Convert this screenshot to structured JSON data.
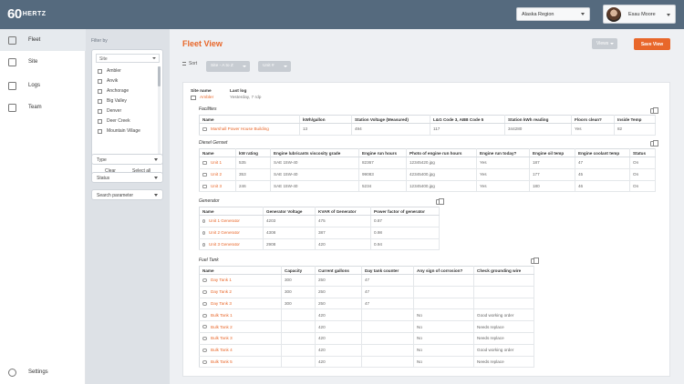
{
  "topbar": {
    "logo_main": "60",
    "logo_sub": "HERTZ",
    "region": "Alaska Region",
    "user": "Esau Moore"
  },
  "sidebar": {
    "items": [
      {
        "label": "Fleet",
        "icon": "hierarchy-icon"
      },
      {
        "label": "Site",
        "icon": "building-icon"
      },
      {
        "label": "Logs",
        "icon": "clipboard-icon"
      },
      {
        "label": "Team",
        "icon": "handshake-icon"
      }
    ],
    "settings": "Settings"
  },
  "filters": {
    "label": "Filter by",
    "site_placeholder": "Site",
    "sites": [
      "Ambler",
      "Anvik",
      "Anchorage",
      "Big Valley",
      "Denver",
      "Deer Creek",
      "Mountain Village"
    ],
    "clear": "Clear",
    "select_all": "Select all",
    "type": "Type",
    "status": "Status",
    "search_param": "Search parameter"
  },
  "main": {
    "title": "Fleet View",
    "views": "Views",
    "save_view": "Save View",
    "sort_label": "Sort",
    "sort_1": "Site - A to Z",
    "sort_2": "Unit #"
  },
  "site": {
    "name_label": "Site name",
    "name": "Ambler",
    "lastlog_label": "Last log",
    "lastlog": "Yesterday, 7 rdp"
  },
  "facilities": {
    "title": "Facilities",
    "headers": [
      "Name",
      "kWh/gallon",
      "Station Voltage (Measured)",
      "L&G Code 3, ABB Code 5",
      "Station kWh reading",
      "Floors clean?",
      "Inside Temp"
    ],
    "rows": [
      [
        "Marshall Power House Building",
        "13",
        "494",
        "117",
        "344280",
        "Yes",
        "82"
      ]
    ]
  },
  "diesel": {
    "title": "Diesel Genset",
    "headers": [
      "Name",
      "kW rating",
      "Engine lubricants viscosity grade",
      "Engine run hours",
      "Photo of engine run hours",
      "Engine run today?",
      "Engine oil temp",
      "Engine coolant temp",
      "Status"
    ],
    "rows": [
      [
        "Unit 1",
        "535",
        "SAE 15W-40",
        "82367",
        "12345420.jpg",
        "Yes",
        "187",
        "47",
        "On"
      ],
      [
        "Unit 2",
        "353",
        "SAE 15W-40",
        "99083",
        "42345400.jpg",
        "Yes",
        "177",
        "45",
        "On"
      ],
      [
        "Unit 3",
        "246",
        "SAE 15W-40",
        "5234",
        "12345400.jpg",
        "Yes",
        "180",
        "46",
        "On"
      ]
    ]
  },
  "generator": {
    "title": "Generator",
    "headers": [
      "Name",
      "Generator Voltage",
      "KVAR of Generator",
      "Power factor of generator"
    ],
    "rows": [
      [
        "Unit 1 Generator",
        "4203",
        "475",
        "0.87"
      ],
      [
        "Unit 2 Generator",
        "4308",
        "387",
        "0.98"
      ],
      [
        "Unit 3 Generator",
        "2908",
        "420",
        "0.94"
      ]
    ]
  },
  "fueltank": {
    "title": "Fuel Tank",
    "headers": [
      "Name",
      "Capacity",
      "Current gallons",
      "Day tank counter",
      "Any sign of corrosion?",
      "Check grounding wire"
    ],
    "rows": [
      [
        "Day Tank 1",
        "300",
        "250",
        "47",
        "",
        ""
      ],
      [
        "Day Tank 2",
        "300",
        "250",
        "47",
        "",
        ""
      ],
      [
        "Day Tank 3",
        "300",
        "250",
        "47",
        "",
        ""
      ],
      [
        "Bulk Tank 1",
        "",
        "420",
        "",
        "No",
        "Good working order"
      ],
      [
        "Bulk Tank 2",
        "",
        "420",
        "",
        "No",
        "Needs replace"
      ],
      [
        "Bulk Tank 3",
        "",
        "420",
        "",
        "No",
        "Needs replace"
      ],
      [
        "Bulk Tank 4",
        "",
        "420",
        "",
        "No",
        "Good working order"
      ],
      [
        "Bulk Tank 5",
        "",
        "420",
        "",
        "No",
        "Needs replace"
      ]
    ]
  }
}
